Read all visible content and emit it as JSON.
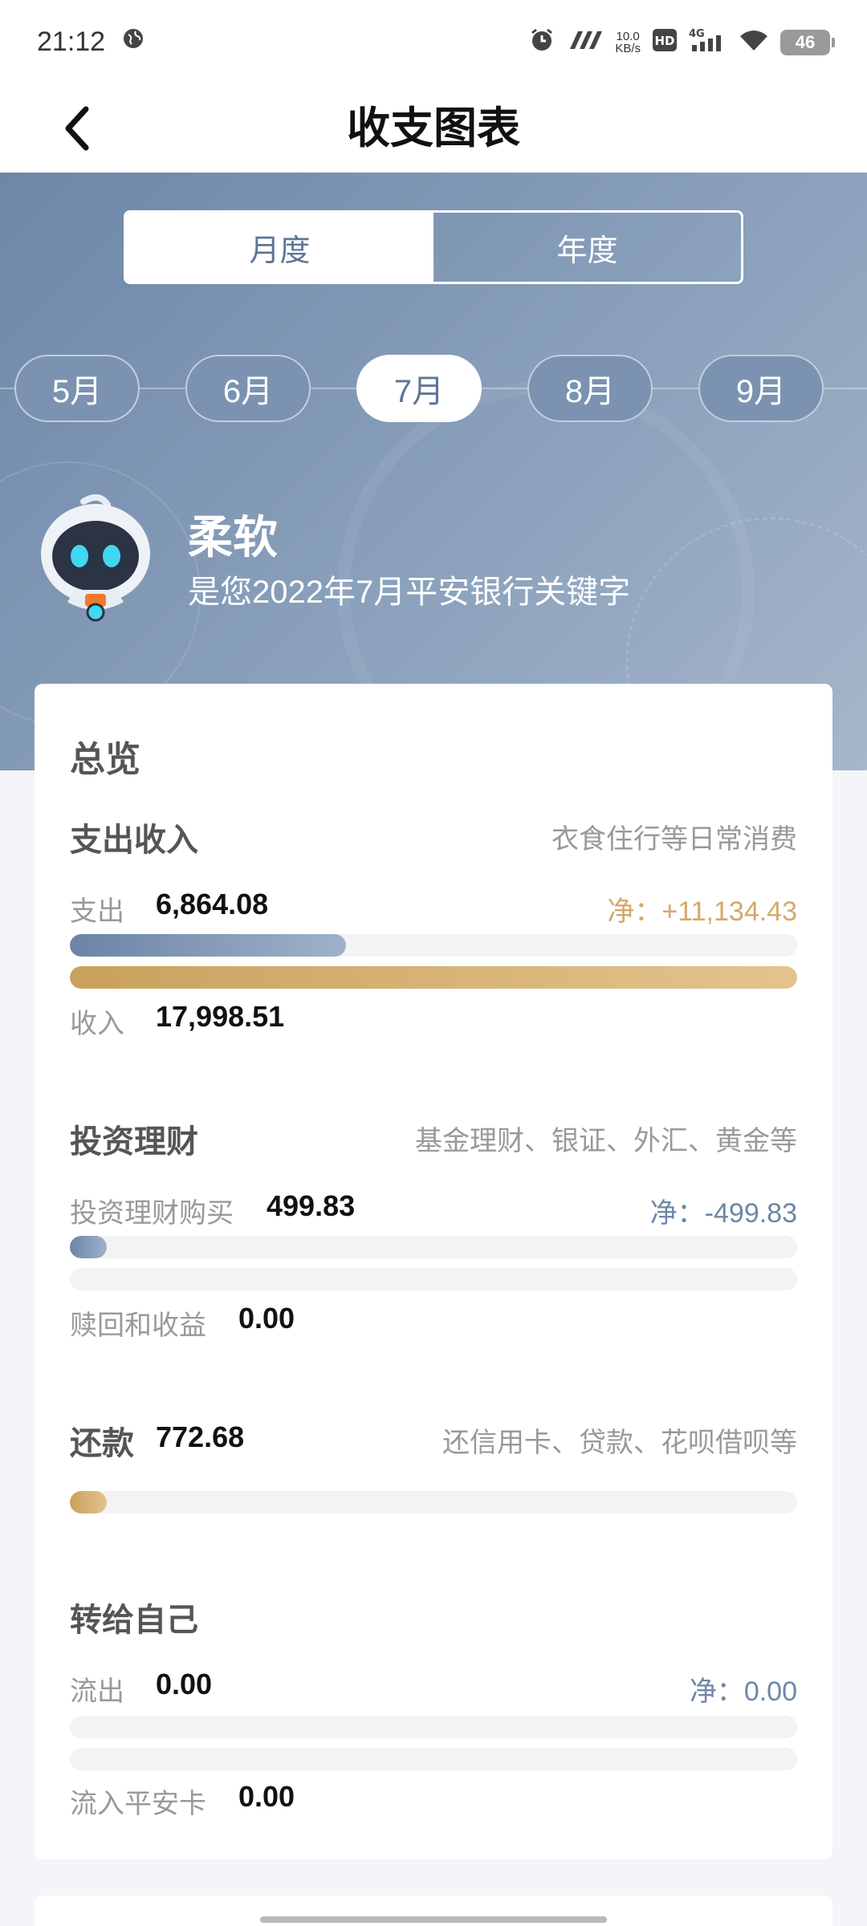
{
  "status_bar": {
    "time": "21:12",
    "net_speed_value": "10.0",
    "net_speed_unit": "KB/s",
    "hd": "HD",
    "network": "4G",
    "battery": "46"
  },
  "nav": {
    "title": "收支图表"
  },
  "period_tabs": [
    {
      "label": "月度",
      "active": true
    },
    {
      "label": "年度",
      "active": false
    }
  ],
  "months": [
    {
      "label": "5月",
      "active": false
    },
    {
      "label": "6月",
      "active": false
    },
    {
      "label": "7月",
      "active": true
    },
    {
      "label": "8月",
      "active": false
    },
    {
      "label": "9月",
      "active": false
    }
  ],
  "keyword": {
    "word": "柔软",
    "subtitle": "是您2022年7月平安银行关键字"
  },
  "overview": {
    "title": "总览",
    "spending_income": {
      "title": "支出收入",
      "desc": "衣食住行等日常消费",
      "expense_label": "支出",
      "expense_value": "6,864.08",
      "net_label": "净：",
      "net_value": "+11,134.43",
      "expense_ratio": 0.38,
      "income_ratio": 1.0,
      "income_label": "收入",
      "income_value": "17,998.51"
    },
    "investment": {
      "title": "投资理财",
      "desc": "基金理财、银证、外汇、黄金等",
      "buy_label": "投资理财购买",
      "buy_value": "499.83",
      "net_label": "净：",
      "net_value": "-499.83",
      "buy_ratio": 0.05,
      "redeem_ratio": 0,
      "redeem_label": "赎回和收益",
      "redeem_value": "0.00"
    },
    "repayment": {
      "title": "还款",
      "value": "772.68",
      "desc": "还信用卡、贷款、花呗借呗等",
      "ratio": 0.05
    },
    "self_transfer": {
      "title": "转给自己",
      "out_label": "流出",
      "out_value": "0.00",
      "net_label": "净：",
      "net_value": "0.00",
      "out_ratio": 0,
      "in_ratio": 0,
      "in_label": "流入平安卡",
      "in_value": "0.00"
    }
  },
  "colors": {
    "accent_blue": "#6e87a8",
    "accent_gold": "#d4a86a"
  }
}
